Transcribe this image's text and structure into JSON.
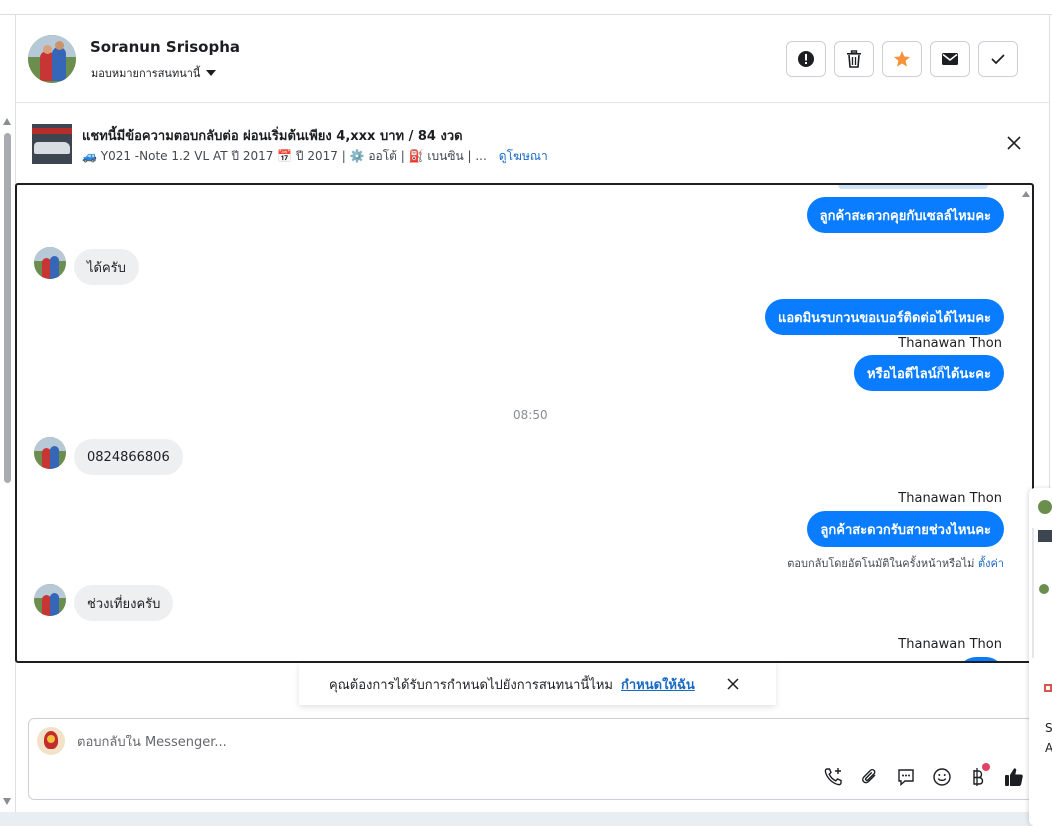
{
  "header": {
    "user_name": "Soranun Srisopha",
    "assign_label": "มอบหมายการสนทนานี้",
    "actions": [
      "exclamation-icon",
      "trash-icon",
      "star-icon",
      "mail-icon",
      "check-icon"
    ],
    "star_color": "#f7923a"
  },
  "ad": {
    "title": "แชทนี้มีข้อความตอบกลับต่อ ผ่อนเริ่มต้นเพียง 4,xxx บาท / 84 งวด",
    "subtitle": "🚙 Y021 -Note 1.2 VL AT ปี 2017 📅 ปี 2017 | ⚙️ ออโต้ | ⛽ เบนซิน | ...",
    "link": "ดูโฆษณา"
  },
  "messages": {
    "m1": "ลูกค้าสะดวกคุยกับเซลล์ไหมคะ",
    "m2": "ได้ครับ",
    "m3": "แอดมินรบกวนขอเบอร์ติดต่อได้ไหมคะ",
    "m3_sender": "Thanawan Thon",
    "m4": "หรือไอดีไลน์ก็ได้นะคะ",
    "time": "08:50",
    "m5": "0824866806",
    "m6_sender": "Thanawan Thon",
    "m6": "ลูกค้าสะดวกรับสายช่วงไหนคะ",
    "auto_note": "ตอบกลับโดยอัตโนมัติในครั้งหน้าหรือไม่",
    "auto_link": "ตั้งค่า",
    "m7": "ช่วงเที่ยงครับ",
    "m8_sender": "Thanawan Thon"
  },
  "toast": {
    "text": "คุณต้องการได้รับการกำหนดไปยังการสนทนานี้ไหม",
    "link": "กำหนดให้ฉัน"
  },
  "composer": {
    "placeholder": "ตอบกลับใน Messenger...",
    "tools": [
      "add-call-icon",
      "attachment-icon",
      "saved-replies-icon",
      "emoji-icon",
      "baht-icon",
      "like-icon"
    ]
  },
  "edge_panel": {
    "letter_s": "S",
    "letter_a": "A"
  },
  "colors": {
    "outgoing_bubble": "#0a7cff",
    "incoming_bubble": "#eeeff1",
    "link": "#1a6ac4"
  }
}
